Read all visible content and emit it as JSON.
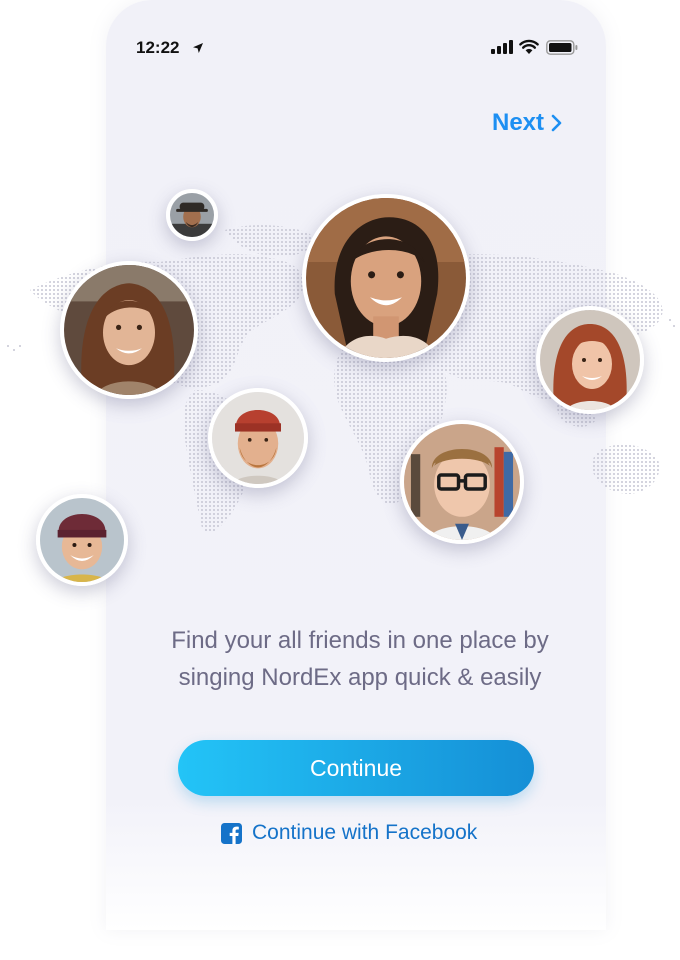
{
  "status_bar": {
    "time": "12:22"
  },
  "header": {
    "next_label": "Next"
  },
  "main": {
    "tagline_line1": "Find your all friends in one place by",
    "tagline_line2": "singing NordEx app quick & easily",
    "continue_label": "Continue",
    "facebook_label": "Continue with Facebook"
  },
  "colors": {
    "accent": "#1d8ff2",
    "button_gradient_start": "#23c4f7",
    "button_gradient_end": "#158fd6",
    "facebook_blue": "#1573c9",
    "tagline": "#6d6b86",
    "background": "#f1f1f8"
  },
  "icons": {
    "location": "location-arrow-icon",
    "signal": "cellular-signal-icon",
    "wifi": "wifi-icon",
    "battery": "battery-icon",
    "next": "chevron-right-icon",
    "facebook": "facebook-icon"
  }
}
